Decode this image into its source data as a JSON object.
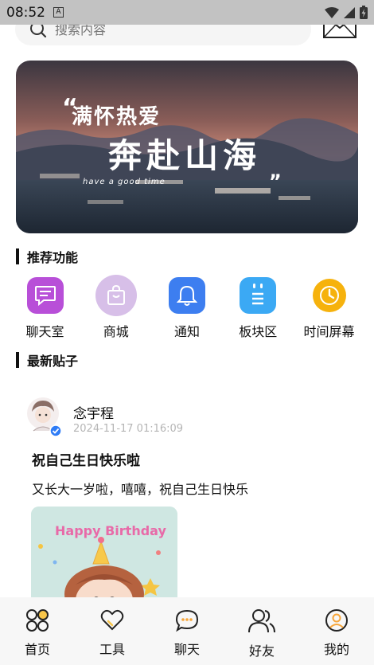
{
  "status": {
    "time": "08:52",
    "notif_letter": "A"
  },
  "search": {
    "placeholder": "搜索内容"
  },
  "banner": {
    "line1": "满怀热爱",
    "line2": "奔赴山海",
    "line3": "have a good time",
    "quote_open": "“",
    "quote_close": "”"
  },
  "features_section": {
    "title": "推荐功能",
    "items": [
      {
        "label": "聊天室",
        "icon": "chat-icon",
        "color": "#b84fd8"
      },
      {
        "label": "商城",
        "icon": "shopping-bag-icon",
        "color": "#d7bfe8"
      },
      {
        "label": "通知",
        "icon": "bell-icon",
        "color": "#3d7ef0"
      },
      {
        "label": "板块区",
        "icon": "notepad-icon",
        "color": "#3ba9f4"
      },
      {
        "label": "时间屏幕",
        "icon": "clock-icon",
        "color": "#f6b20d"
      }
    ]
  },
  "posts_section": {
    "title": "最新贴子",
    "post": {
      "author": "念宇程",
      "time": "2024-11-17 01:16:09",
      "title": "祝自己生日快乐啦",
      "body": "又长大一岁啦，嘻嘻，祝自己生日快乐",
      "image_text": "Happy Birthday"
    }
  },
  "tabbar": {
    "items": [
      {
        "label": "首页",
        "icon": "home-icon"
      },
      {
        "label": "工具",
        "icon": "heart-icon"
      },
      {
        "label": "聊天",
        "icon": "chat-bubble-icon"
      },
      {
        "label": "好友",
        "icon": "friends-icon"
      },
      {
        "label": "我的",
        "icon": "profile-icon"
      }
    ]
  },
  "colors": {
    "accent_blue": "#3d7ef0",
    "check_blue": "#2f7cf6"
  }
}
